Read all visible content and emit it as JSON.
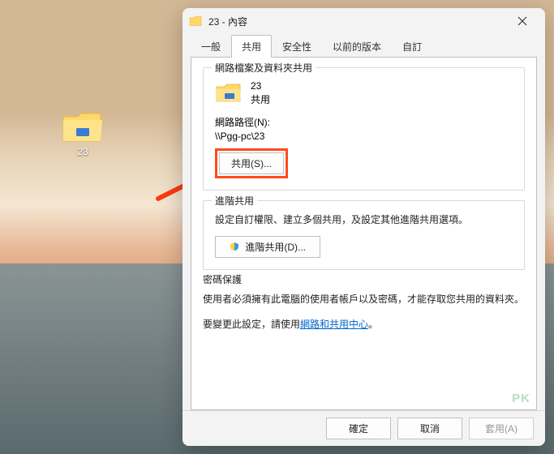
{
  "desktop": {
    "icon_label": "23"
  },
  "dialog": {
    "title": "23 - 內容",
    "tabs": {
      "general": "一般",
      "sharing": "共用",
      "security": "安全性",
      "previous": "以前的版本",
      "custom": "自訂"
    },
    "group_network": {
      "title": "網路檔案及資料夾共用",
      "name": "23",
      "status": "共用",
      "path_label": "網路路徑(N):",
      "path_value": "\\\\Pgg-pc\\23",
      "share_button": "共用(S)..."
    },
    "group_advanced": {
      "title": "進階共用",
      "desc": "設定自訂權限、建立多個共用，及設定其他進階共用選項。",
      "button": "進階共用(D)..."
    },
    "group_password": {
      "title": "密碼保護",
      "line1": "使用者必須擁有此電腦的使用者帳戶以及密碼，才能存取您共用的資料夾。",
      "line2_prefix": "要變更此設定，請使用",
      "link": "網路和共用中心",
      "line2_suffix": "。"
    },
    "footer": {
      "ok": "確定",
      "cancel": "取消",
      "apply": "套用(A)"
    },
    "watermark": "PK"
  }
}
